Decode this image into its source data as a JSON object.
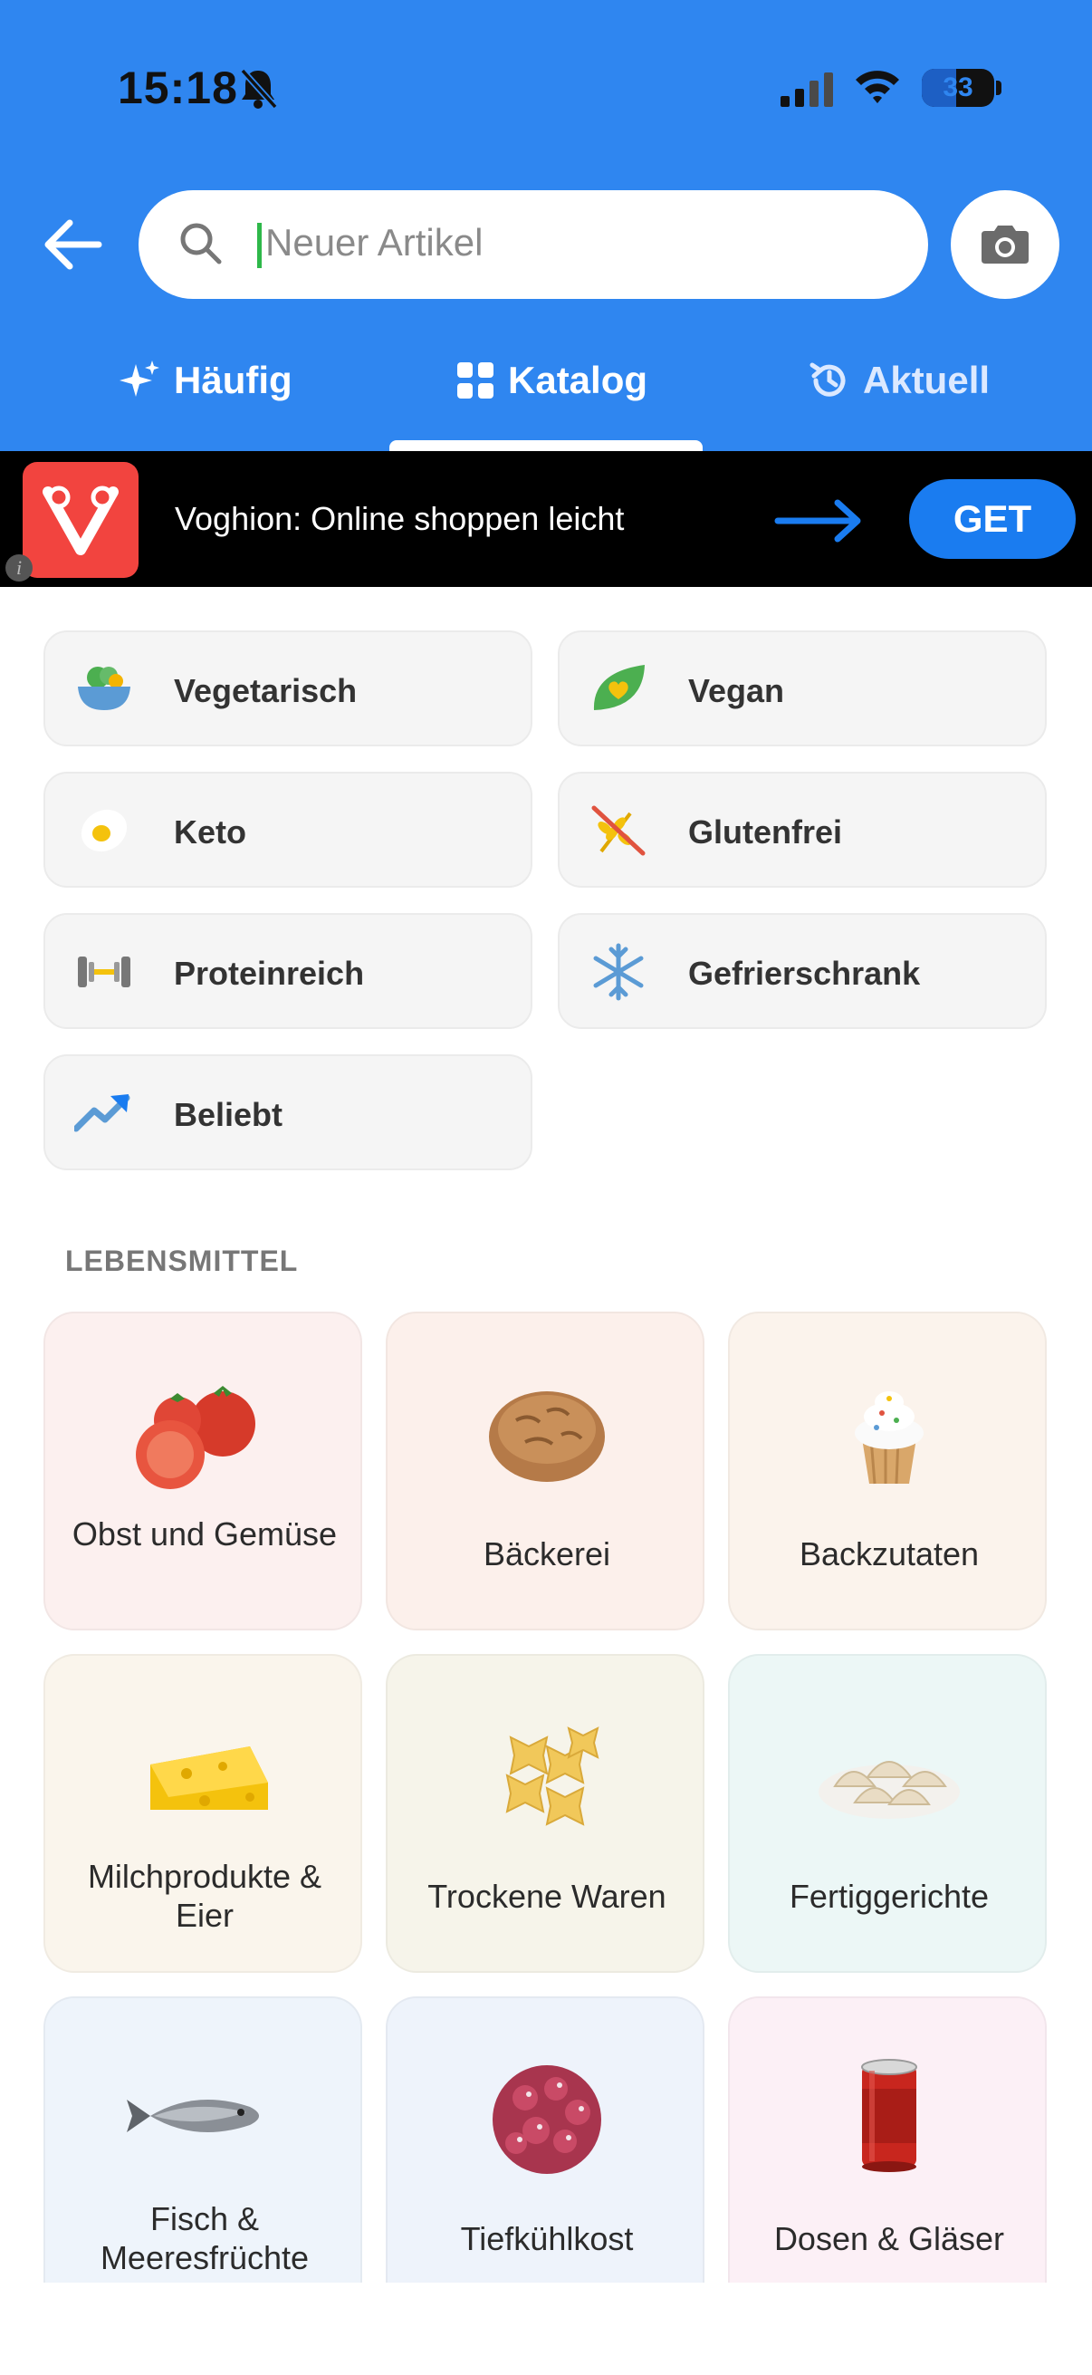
{
  "status_bar": {
    "time": "15:18",
    "battery": "33"
  },
  "search": {
    "placeholder": "Neuer Artikel"
  },
  "tabs": [
    {
      "label": "Häufig"
    },
    {
      "label": "Katalog"
    },
    {
      "label": "Aktuell"
    }
  ],
  "ad": {
    "text": "Voghion: Online shoppen leicht",
    "cta": "GET",
    "info": "i"
  },
  "chips": [
    {
      "label": "Vegetarisch",
      "icon": "salad-bowl-icon"
    },
    {
      "label": "Vegan",
      "icon": "leaf-heart-icon"
    },
    {
      "label": "Keto",
      "icon": "egg-icon"
    },
    {
      "label": "Glutenfrei",
      "icon": "no-wheat-icon"
    },
    {
      "label": "Proteinreich",
      "icon": "dumbbell-icon"
    },
    {
      "label": "Gefrierschrank",
      "icon": "snowflake-icon"
    },
    {
      "label": "Beliebt",
      "icon": "trending-up-icon"
    }
  ],
  "section": {
    "title": "LEBENSMITTEL"
  },
  "categories": [
    {
      "label": "Obst und Gemüse",
      "bg": "#fcf0ef",
      "icon": "tomatoes-icon"
    },
    {
      "label": "Bäckerei",
      "bg": "#fcf0eb",
      "icon": "bread-icon"
    },
    {
      "label": "Backzutaten",
      "bg": "#fbf3ec",
      "icon": "cupcake-icon"
    },
    {
      "label": "Milchprodukte & Eier",
      "bg": "#faf5ec",
      "icon": "cheese-icon"
    },
    {
      "label": "Trockene Waren",
      "bg": "#f6f4ea",
      "icon": "pasta-icon"
    },
    {
      "label": "Fertiggerichte",
      "bg": "#ecf7f6",
      "icon": "dumplings-icon"
    },
    {
      "label": "Fisch & Meeresfrüchte",
      "bg": "#eef4fb",
      "icon": "fish-icon"
    },
    {
      "label": "Tiefkühlkost",
      "bg": "#eef3fb",
      "icon": "frozen-berries-icon"
    },
    {
      "label": "Dosen & Gläser",
      "bg": "#fcf0f6",
      "icon": "can-icon"
    }
  ],
  "colors": {
    "header": "#2f86f0",
    "accent": "#1a7cf0",
    "ad_logo": "#f2443f"
  }
}
